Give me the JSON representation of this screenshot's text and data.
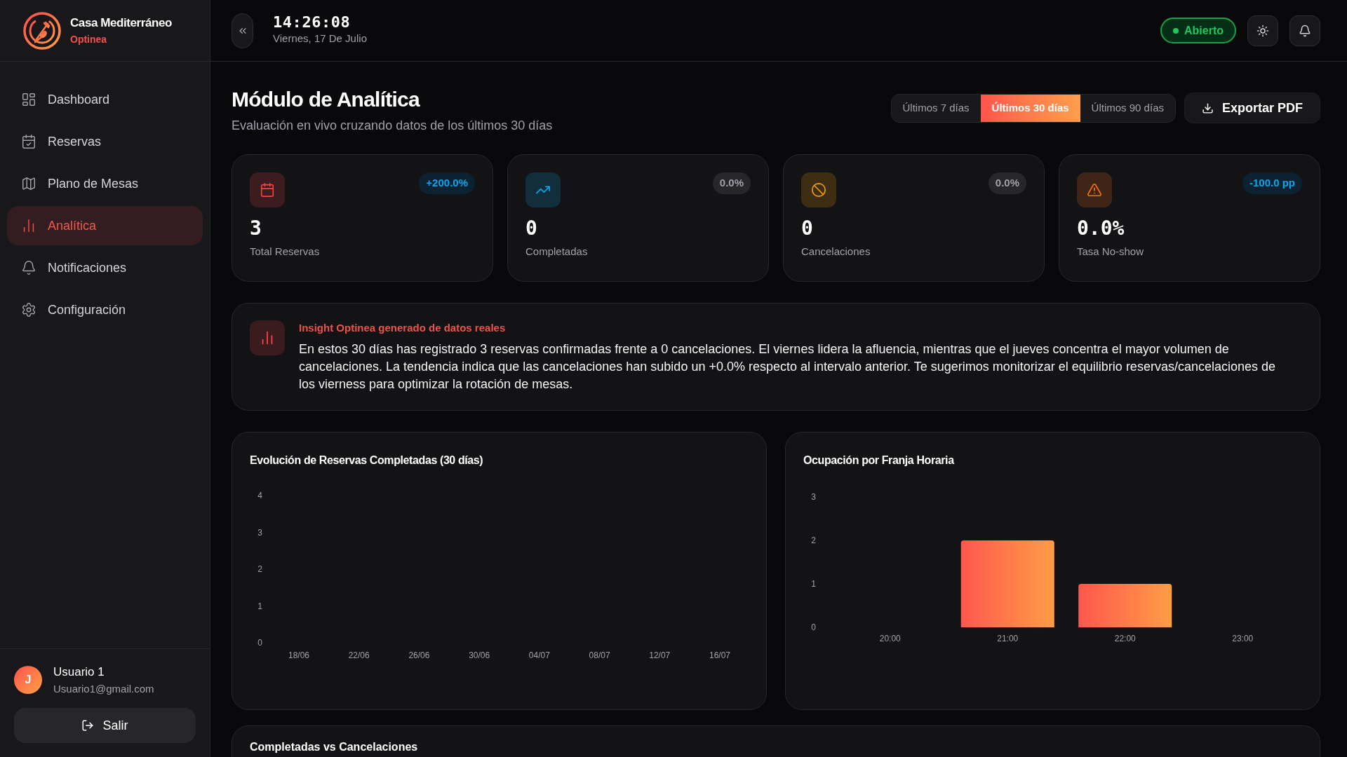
{
  "brand": {
    "name": "Casa Mediterráneo",
    "subtitle": "Optinea"
  },
  "nav": [
    {
      "kind": "dashboard",
      "label": "Dashboard",
      "selected": false
    },
    {
      "kind": "reservations",
      "label": "Reservas",
      "selected": false
    },
    {
      "kind": "map",
      "label": "Plano de Mesas",
      "selected": false
    },
    {
      "kind": "analytics",
      "label": "Analítica",
      "selected": true
    },
    {
      "kind": "notifications",
      "label": "Notificaciones",
      "selected": false
    },
    {
      "kind": "settings",
      "label": "Configuración",
      "selected": false
    }
  ],
  "user": {
    "initial": "J",
    "name": "Usuario 1",
    "email": "Usuario1@gmail.com"
  },
  "logout_button": "Salir",
  "header": {
    "time": "14:26:08",
    "date": "Viernes, 17 De Julio",
    "status": {
      "label": "Abierto",
      "open": true
    }
  },
  "page": {
    "title": "Módulo de Analítica",
    "subtitle": "Evaluación en vivo cruzando datos de los últimos 30 días"
  },
  "period_tabs": [
    {
      "label": "Últimos 7 días",
      "selected": false
    },
    {
      "label": "Últimos 30 días",
      "selected": true
    },
    {
      "label": "Últimos 90 días",
      "selected": false
    }
  ],
  "export_button": "Exportar PDF",
  "stat_cards": [
    {
      "kind": "calendar",
      "color": "#ef4444",
      "badge": "+200.0%",
      "highlight": true,
      "value": "3",
      "label": "Total Reservas"
    },
    {
      "kind": "trend",
      "color": "#0ea5e9",
      "badge": "0.0%",
      "highlight": false,
      "value": "0",
      "label": "Completadas"
    },
    {
      "kind": "ban",
      "color": "#f59e0b",
      "badge": "0.0%",
      "highlight": false,
      "value": "0",
      "label": "Cancelaciones"
    },
    {
      "kind": "warning",
      "color": "#f97316",
      "badge": "-100.0 pp",
      "highlight": true,
      "value": "0.0%",
      "label": "Tasa No-show"
    }
  ],
  "insight": {
    "title": "Insight Optinea generado de datos reales",
    "text": "En estos 30 días has registrado 3 reservas confirmadas frente a 0 cancelaciones. El viernes lidera la afluencia, mientras que el jueves concentra el mayor volumen de cancelaciones. La tendencia indica que las cancelaciones han subido un +0.0% respecto al intervalo anterior. Te sugerimos monitorizar el equilibrio reservas/cancelaciones de los vierness para optimizar la rotación de mesas."
  },
  "charts": [
    {
      "chart_data": {
        "type": "line",
        "title": "Evolución de Reservas Completadas (30 días)",
        "categories": [
          "18/06",
          "22/06",
          "26/06",
          "30/06",
          "04/07",
          "08/07",
          "12/07",
          "16/07"
        ],
        "ylim": [
          0,
          4
        ],
        "yticks": [
          0,
          1,
          2,
          3,
          4
        ]
      }
    },
    {
      "chart_data": {
        "type": "bar",
        "title": "Ocupación por Franja Horaria",
        "categories": [
          "20:00",
          "21:00",
          "22:00",
          "23:00"
        ],
        "values": [
          0,
          2,
          1,
          0
        ],
        "ylim": [
          0,
          3
        ],
        "yticks": [
          0,
          1,
          2,
          3
        ]
      }
    }
  ],
  "next_section": {
    "title": "Completadas vs Cancelaciones"
  }
}
